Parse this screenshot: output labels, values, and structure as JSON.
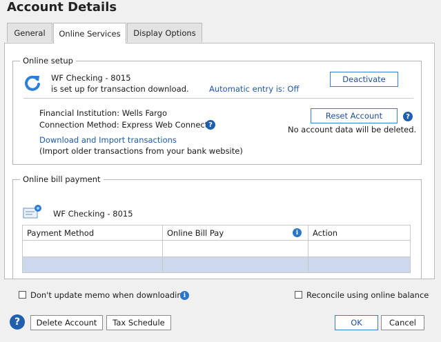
{
  "window": {
    "title": "Account Details"
  },
  "tabs": [
    {
      "label": "General"
    },
    {
      "label": "Online Services"
    },
    {
      "label": "Display Options"
    }
  ],
  "online_setup": {
    "legend": "Online setup",
    "account_name": "WF Checking - 8015",
    "status_text": "is set up for transaction download.",
    "auto_entry": "Automatic entry is: Off",
    "deactivate_label": "Deactivate",
    "fi_label": "Financial Institution: Wells Fargo",
    "connection_label": "Connection Method: Express Web Connect+",
    "download_link": "Download and Import transactions",
    "download_note": "(Import older transactions from your bank website)",
    "reset_label": "Reset Account",
    "reset_note": "No account data will be deleted."
  },
  "bill_payment": {
    "legend": "Online bill payment",
    "account_name": "WF Checking - 8015",
    "columns": [
      "Payment Method",
      "Online Bill Pay",
      "Action"
    ],
    "rows": [
      [
        "",
        "",
        ""
      ],
      [
        "",
        "",
        ""
      ]
    ]
  },
  "options": {
    "memo_label": "Don't update memo when downloading",
    "memo_checked": false,
    "reconcile_label": "Reconcile using online balance",
    "reconcile_checked": false
  },
  "footer": {
    "help_icon": "question-icon",
    "delete_label": "Delete Account",
    "tax_label": "Tax Schedule",
    "ok_label": "OK",
    "cancel_label": "Cancel"
  },
  "colors": {
    "accent": "#1e5aa8",
    "selected_row": "#cdd8ec",
    "button_border": "#3a7bd5"
  }
}
